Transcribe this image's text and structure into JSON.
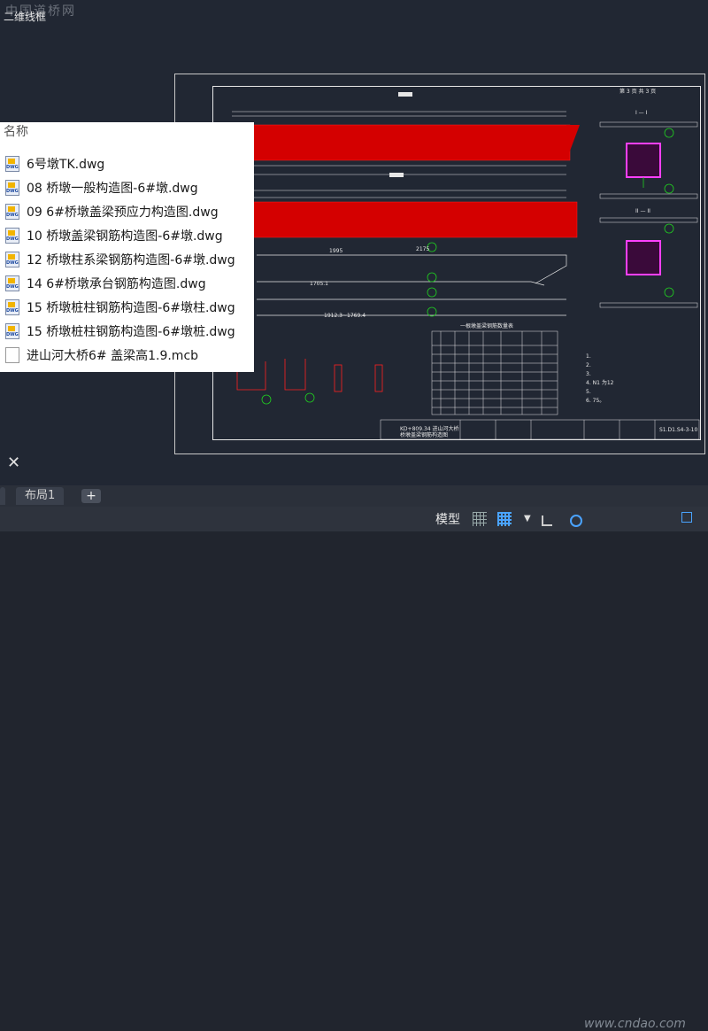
{
  "watermark_top": "中国道桥网",
  "view_label": "二维线框",
  "file_list": {
    "header": "名称",
    "items": [
      {
        "name": "6号墩TK.dwg",
        "icon": "dwg-icon"
      },
      {
        "name": "08 桥墩一般构造图-6#墩.dwg",
        "icon": "dwg-icon"
      },
      {
        "name": "09 6#桥墩盖梁预应力构造图.dwg",
        "icon": "dwg-icon"
      },
      {
        "name": "10 桥墩盖梁钢筋构造图-6#墩.dwg",
        "icon": "dwg-icon"
      },
      {
        "name": "12 桥墩柱系梁钢筋构造图-6#墩.dwg",
        "icon": "dwg-icon"
      },
      {
        "name": "14 6#桥墩承台钢筋构造图.dwg",
        "icon": "dwg-icon"
      },
      {
        "name": "15 桥墩桩柱钢筋构造图-6#墩柱.dwg",
        "icon": "dwg-icon"
      },
      {
        "name": "15 桥墩桩柱钢筋构造图-6#墩桩.dwg",
        "icon": "dwg-icon"
      },
      {
        "name": "进山河大桥6# 盖梁高1.9.mcb",
        "icon": "document-icon"
      }
    ]
  },
  "drawing": {
    "sheet_no": "第 3 页 共 3 页",
    "section_a": "I — I",
    "section_b": "II — II",
    "title_block": "KD+809.34 进山河大桥",
    "subtitle": "桥墩盖梁钢筋构造图",
    "drawing_id": "S1.D1.S4-3-10",
    "table_title": "一根墩盖梁钢筋数量表",
    "dims": [
      "2175",
      "1705.1",
      "1912.3~1769.4",
      "1995"
    ],
    "notes": [
      "1.",
      "2.",
      "3.",
      "4. N1 为12",
      "5.",
      "6. 75。"
    ],
    "colors": {
      "rebar": "#ff2020",
      "outline": "#e6e6e6",
      "green": "#20d020",
      "magenta": "#ff40ff",
      "yellow": "#e8e86a"
    }
  },
  "tabs": [
    {
      "label": ""
    },
    {
      "label": "布局1"
    },
    {
      "label": "+"
    }
  ],
  "statusbar": {
    "model_label": "模型",
    "site_watermark": "www.cndao.com"
  }
}
